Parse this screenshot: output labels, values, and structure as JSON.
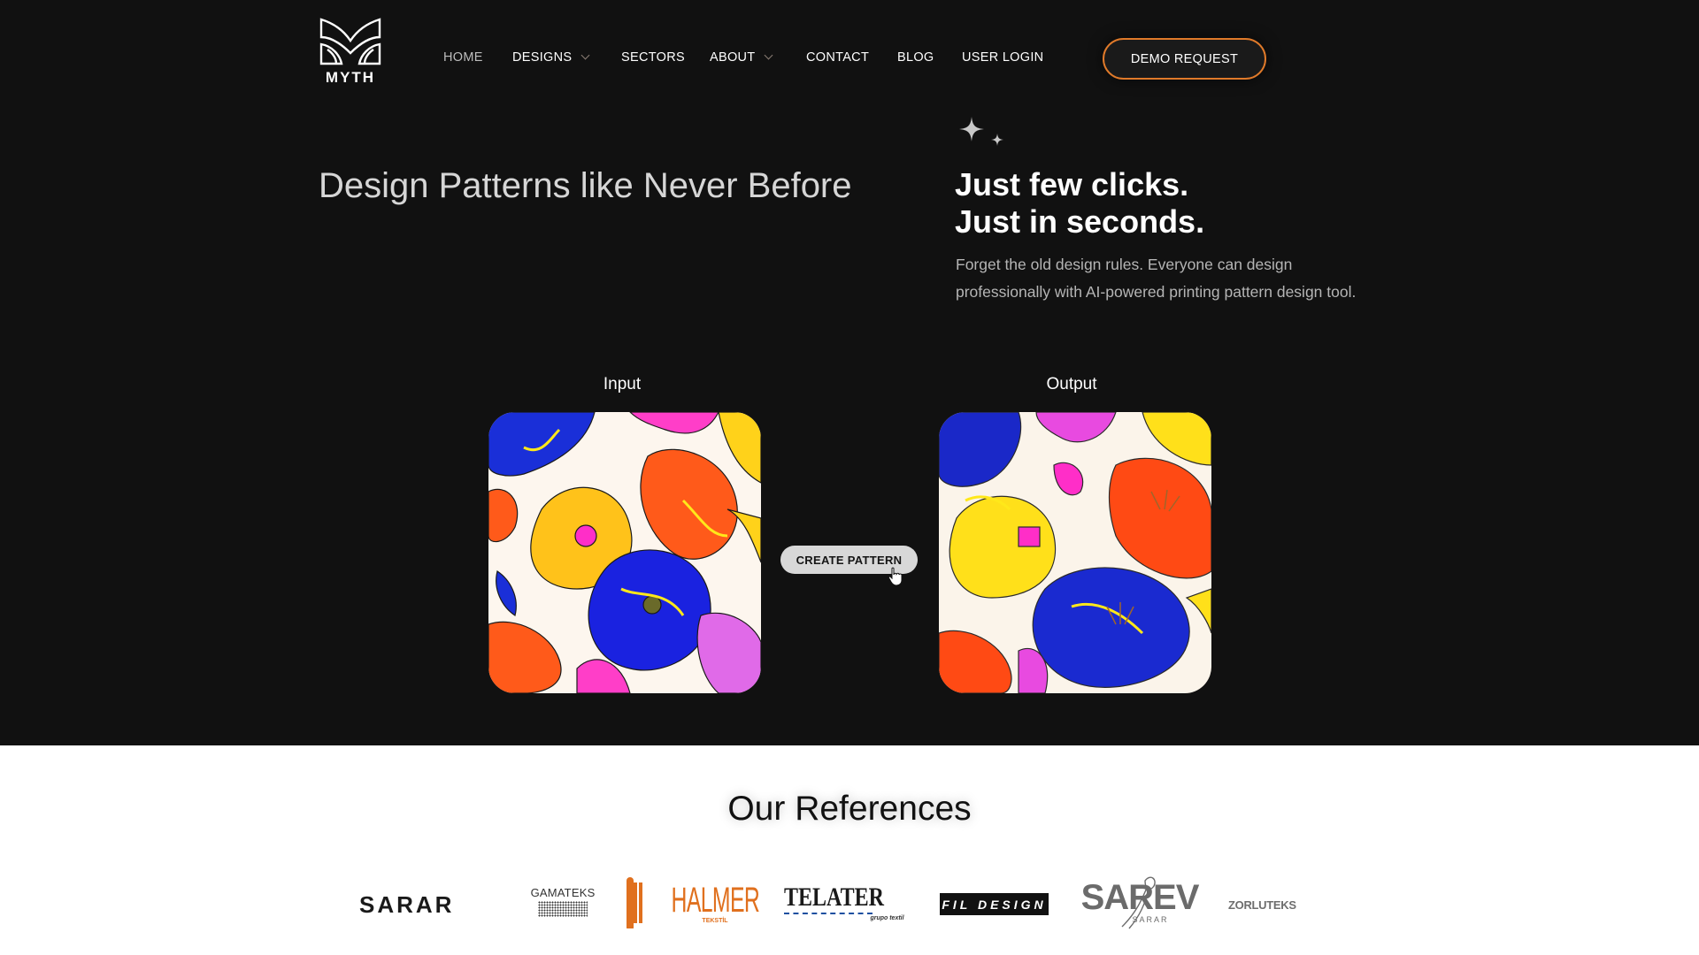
{
  "brand": {
    "logo_text": "MYTH",
    "logo_icon": "myth-m-monogram-icon"
  },
  "nav": {
    "items": [
      {
        "label": "HOME",
        "active": true,
        "has_dropdown": false
      },
      {
        "label": "DESIGNS",
        "active": false,
        "has_dropdown": true
      },
      {
        "label": "SECTORS",
        "active": false,
        "has_dropdown": false
      },
      {
        "label": "ABOUT",
        "active": false,
        "has_dropdown": true
      },
      {
        "label": "CONTACT",
        "active": false,
        "has_dropdown": false
      },
      {
        "label": "BLOG",
        "active": false,
        "has_dropdown": false
      },
      {
        "label": "USER LOGIN",
        "active": false,
        "has_dropdown": false
      }
    ],
    "cta_label": "DEMO REQUEST"
  },
  "hero": {
    "title": "Design Patterns like Never Before",
    "sparkle_icon": "sparkles-icon",
    "tagline_line1": "Just few clicks.",
    "tagline_line2": "Just in seconds.",
    "description": "Forget the old design rules. Everyone can design professionally with AI-powered printing pattern design tool."
  },
  "demo": {
    "input_label": "Input",
    "output_label": "Output",
    "create_button_label": "CREATE PATTERN",
    "cursor_icon": "hand-pointer-icon"
  },
  "references": {
    "title": "Our References",
    "logos": [
      {
        "name": "SARAR"
      },
      {
        "name": "GAMATEKS"
      },
      {
        "name": "HALMER",
        "subtitle": "TEKSTİL"
      },
      {
        "name": "TELATER",
        "subtitle": "grupo textil"
      },
      {
        "name": "FIL DESIGN"
      },
      {
        "name": "SAREV",
        "subtitle": "SARAR"
      },
      {
        "name": "ZORLUTEKS"
      }
    ]
  },
  "colors": {
    "background_dark": "#111111",
    "accent_orange": "#e07a2a",
    "nav_active": "#bdbdbd",
    "button_light": "#d8d8d8"
  }
}
